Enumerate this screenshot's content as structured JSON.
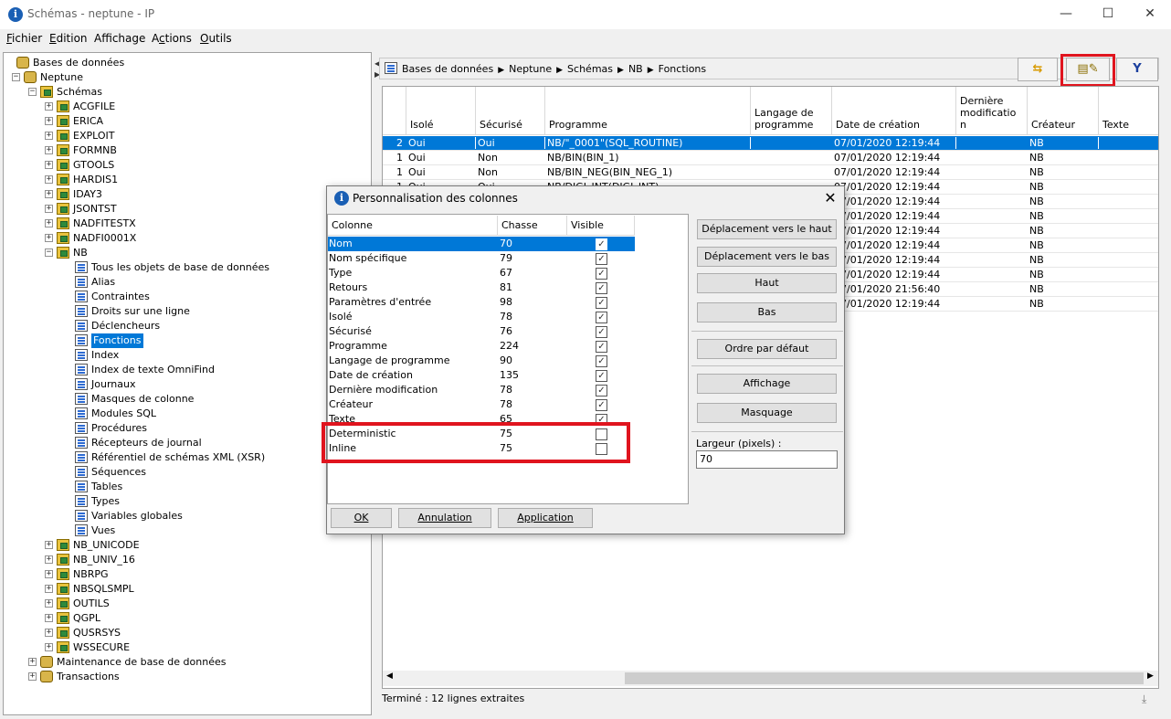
{
  "window": {
    "title": "Schémas - neptune - IP",
    "minimize": "—",
    "maximize": "☐",
    "close": "✕"
  },
  "menu": [
    {
      "mnemonic": "F",
      "rest": "ichier"
    },
    {
      "mnemonic": "E",
      "rest": "dition"
    },
    {
      "pre": "Aff",
      "mnemonic": "i",
      "rest": "chage"
    },
    {
      "pre": "A",
      "mnemonic": "c",
      "rest": "tions"
    },
    {
      "mnemonic": "O",
      "rest": "utils"
    }
  ],
  "tree": {
    "root": "Bases de données",
    "system": "Neptune",
    "schemas": "Schémas",
    "schema_list_top": [
      "ACGFILE",
      "ERICA",
      "EXPLOIT",
      "FORMNB",
      "GTOOLS",
      "HARDIS1",
      "IDAY3",
      "JSONTST",
      "NADFITESTX",
      "NADFI0001X",
      "NB"
    ],
    "nb_children": [
      "Tous les objets de base de données",
      "Alias",
      "Contraintes",
      "Droits sur une ligne",
      "Déclencheurs",
      "Fonctions",
      "Index",
      "Index de texte OmniFind",
      "Journaux",
      "Masques de colonne",
      "Modules SQL",
      "Procédures",
      "Récepteurs de journal",
      "Référentiel de schémas XML (XSR)",
      "Séquences",
      "Tables",
      "Types",
      "Variables globales",
      "Vues"
    ],
    "selected_child": "Fonctions",
    "schema_list_bottom": [
      "NB_UNICODE",
      "NB_UNIV_16",
      "NBRPG",
      "NBSQLSMPL",
      "OUTILS",
      "QGPL",
      "QUSRSYS",
      "WSSECURE"
    ],
    "other": [
      "Maintenance de base de données",
      "Transactions"
    ]
  },
  "breadcrumb": [
    "Bases de données",
    "Neptune",
    "Schémas",
    "NB",
    "Fonctions"
  ],
  "breadcrumb_sep": "▶",
  "toolbar": {
    "refresh_icon": "refresh-icon",
    "columns_icon": "customize-columns-icon",
    "filter_icon": "filter-icon",
    "filter_glyph": "Y"
  },
  "grid": {
    "headers": [
      "",
      "Isolé",
      "Sécurisé",
      "Programme",
      "Langage de\nprogramme",
      "Date de création",
      "Dernière\nmodificatio\nn",
      "Créateur",
      "Texte"
    ],
    "rows": [
      [
        "2",
        "Oui",
        "Oui",
        "NB/\"_0001\"(SQL_ROUTINE)",
        "",
        "07/01/2020 12:19:44",
        "",
        "NB",
        ""
      ],
      [
        "1",
        "Oui",
        "Non",
        "NB/BIN(BIN_1)",
        "",
        "07/01/2020 12:19:44",
        "",
        "NB",
        ""
      ],
      [
        "1",
        "Oui",
        "Non",
        "NB/BIN_NEG(BIN_NEG_1)",
        "",
        "07/01/2020 12:19:44",
        "",
        "NB",
        ""
      ],
      [
        "1",
        "Oui",
        "Oui",
        "NB/DIGI_INT(DIGI_INT)",
        "",
        "07/01/2020 12:19:44",
        "",
        "NB",
        ""
      ],
      [
        "",
        "",
        "",
        "",
        "",
        "07/01/2020 12:19:44",
        "",
        "NB",
        ""
      ],
      [
        "",
        "",
        "",
        "",
        "",
        "07/01/2020 12:19:44",
        "",
        "NB",
        ""
      ],
      [
        "",
        "",
        "",
        "",
        "",
        "07/01/2020 12:19:44",
        "",
        "NB",
        ""
      ],
      [
        "",
        "",
        "",
        "",
        "",
        "07/01/2020 12:19:44",
        "",
        "NB",
        ""
      ],
      [
        "",
        "",
        "",
        "",
        "",
        "07/01/2020 12:19:44",
        "",
        "NB",
        ""
      ],
      [
        "",
        "",
        "",
        "",
        "",
        "07/01/2020 12:19:44",
        "",
        "NB",
        ""
      ],
      [
        "",
        "",
        "",
        "",
        "",
        "07/01/2020 21:56:40",
        "",
        "NB",
        ""
      ],
      [
        "",
        "",
        "",
        "",
        "",
        "07/01/2020 12:19:44",
        "",
        "NB",
        ""
      ]
    ],
    "selected_row": 0
  },
  "status": "Terminé : 12 lignes extraites",
  "download_icon": "download-icon",
  "dialog": {
    "title": "Personnalisation des colonnes",
    "close": "✕",
    "headers": [
      "Colonne",
      "Chasse",
      "Visible"
    ],
    "rows": [
      {
        "name": "Nom",
        "width": "70",
        "visible": true
      },
      {
        "name": "Nom spécifique",
        "width": "79",
        "visible": true
      },
      {
        "name": "Type",
        "width": "67",
        "visible": true
      },
      {
        "name": "Retours",
        "width": "81",
        "visible": true
      },
      {
        "name": "Paramètres d'entrée",
        "width": "98",
        "visible": true
      },
      {
        "name": "Isolé",
        "width": "78",
        "visible": true
      },
      {
        "name": "Sécurisé",
        "width": "76",
        "visible": true
      },
      {
        "name": "Programme",
        "width": "224",
        "visible": true
      },
      {
        "name": "Langage de programme",
        "width": "90",
        "visible": true
      },
      {
        "name": "Date de création",
        "width": "135",
        "visible": true
      },
      {
        "name": "Dernière modification",
        "width": "78",
        "visible": true
      },
      {
        "name": "Créateur",
        "width": "78",
        "visible": true
      },
      {
        "name": "Texte",
        "width": "65",
        "visible": true
      },
      {
        "name": "Deterministic",
        "width": "75",
        "visible": false
      },
      {
        "name": "Inline",
        "width": "75",
        "visible": false
      }
    ],
    "selected_row": 0,
    "buttons": {
      "move_up": "Déplacement vers le haut",
      "move_down": "Déplacement vers le bas",
      "top": "Haut",
      "bottom": "Bas",
      "default_order": "Ordre par défaut",
      "show": "Affichage",
      "hide": "Masquage"
    },
    "width_label": "Largeur (pixels) :",
    "width_value": "70",
    "ok": "OK",
    "cancel": "Annulation",
    "apply": "Application"
  }
}
